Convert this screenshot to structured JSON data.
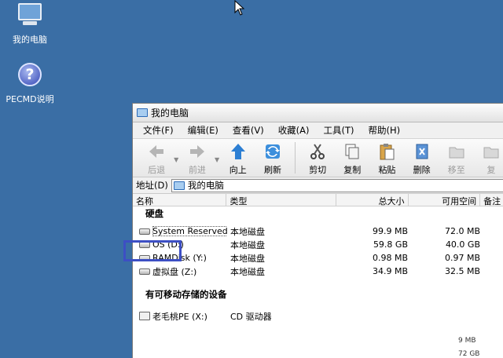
{
  "desktop": {
    "icons": [
      {
        "label": "我的电脑",
        "icon": "computer-icon"
      },
      {
        "label": "PECMD说明",
        "icon": "help-icon"
      }
    ]
  },
  "window": {
    "title": "我的电脑",
    "menu": [
      "文件(F)",
      "编辑(E)",
      "查看(V)",
      "收藏(A)",
      "工具(T)",
      "帮助(H)"
    ],
    "toolbar": {
      "back": "后退",
      "forward": "前进",
      "up": "向上",
      "refresh": "刷新",
      "cut": "剪切",
      "copy": "复制",
      "paste": "粘贴",
      "delete": "删除",
      "move": "移至",
      "copyto": "复"
    },
    "address": {
      "label": "地址(D)",
      "value": "我的电脑"
    },
    "columns": {
      "name": "名称",
      "type": "类型",
      "total": "总大小",
      "free": "可用空间",
      "note": "备注"
    },
    "groups": {
      "hdd": "硬盘",
      "removable": "有可移动存储的设备"
    },
    "drives": [
      {
        "name": "System Reserved...",
        "type": "本地磁盘",
        "total": "99.9 MB",
        "free": "72.0 MB"
      },
      {
        "name": "OS (D:)",
        "type": "本地磁盘",
        "total": "59.8 GB",
        "free": "40.0 GB"
      },
      {
        "name": "RAMDisk (Y:)",
        "type": "本地磁盘",
        "total": "0.98 MB",
        "free": "0.97 MB"
      },
      {
        "name": "虚拟盘 (Z:)",
        "type": "本地磁盘",
        "total": "34.9 MB",
        "free": "32.5 MB"
      }
    ],
    "removable": [
      {
        "name": "老毛桃PE (X:)",
        "type": "CD 驱动器"
      }
    ],
    "cut_off": [
      "9 MB",
      "72 GB"
    ]
  },
  "colors": {
    "desktop": "#3a6ea5",
    "highlight": "#3d4fc4"
  }
}
